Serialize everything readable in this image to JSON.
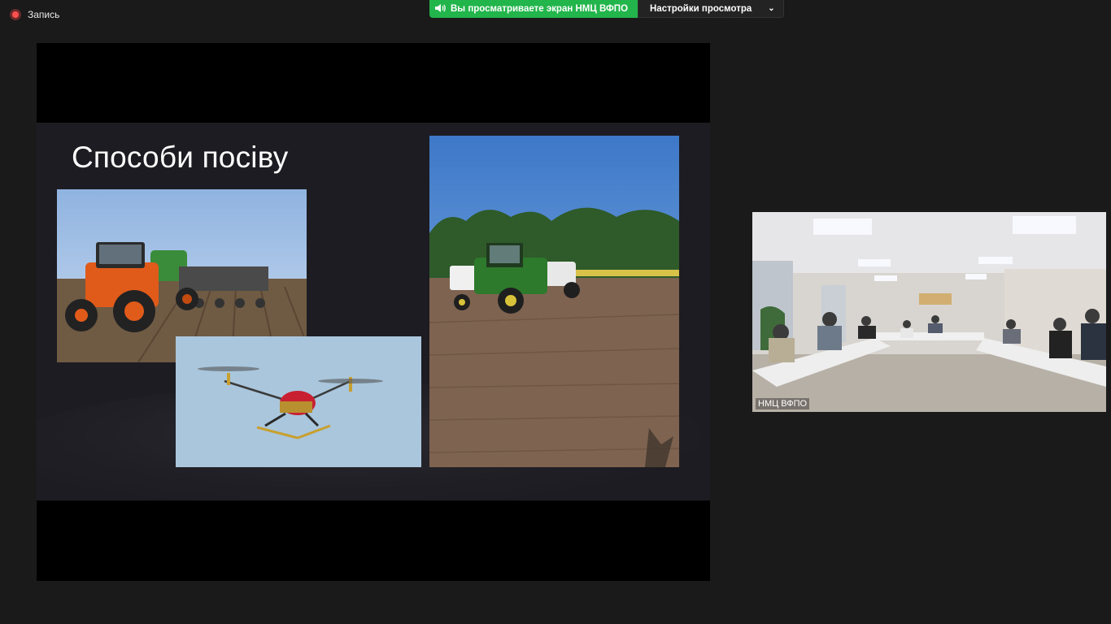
{
  "recording": {
    "label": "Запись",
    "icon": "record-icon"
  },
  "banner": {
    "viewing_text": "Вы просматриваете экран НМЦ ВФПО",
    "viewing_icon": "speaker-icon",
    "settings_label": "Настройки просмотра",
    "settings_icon": "chevron-down-icon"
  },
  "slide": {
    "title": "Способи посіву",
    "images": [
      "tractor-seeder-photo",
      "agricultural-drone-photo",
      "tractor-field-photo"
    ]
  },
  "participant": {
    "name": "НМЦ ВФПО"
  },
  "colors": {
    "accent_green": "#22b54b",
    "record_red": "#ff4f4f",
    "background": "#1a1a1a"
  }
}
